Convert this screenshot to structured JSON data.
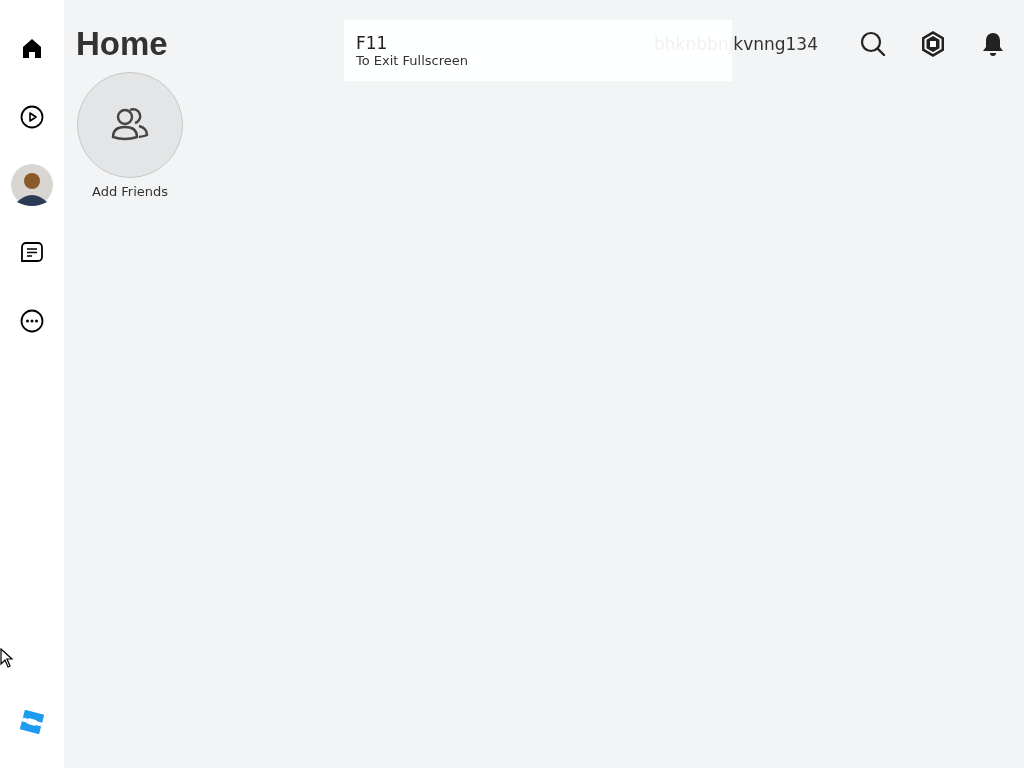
{
  "page": {
    "title": "Home"
  },
  "overlay": {
    "key": "F11",
    "hint": "To Exit Fullscreen"
  },
  "header": {
    "username": "bhknbbnjkvnng134"
  },
  "friends": [
    {
      "label": "Add Friends"
    }
  ]
}
